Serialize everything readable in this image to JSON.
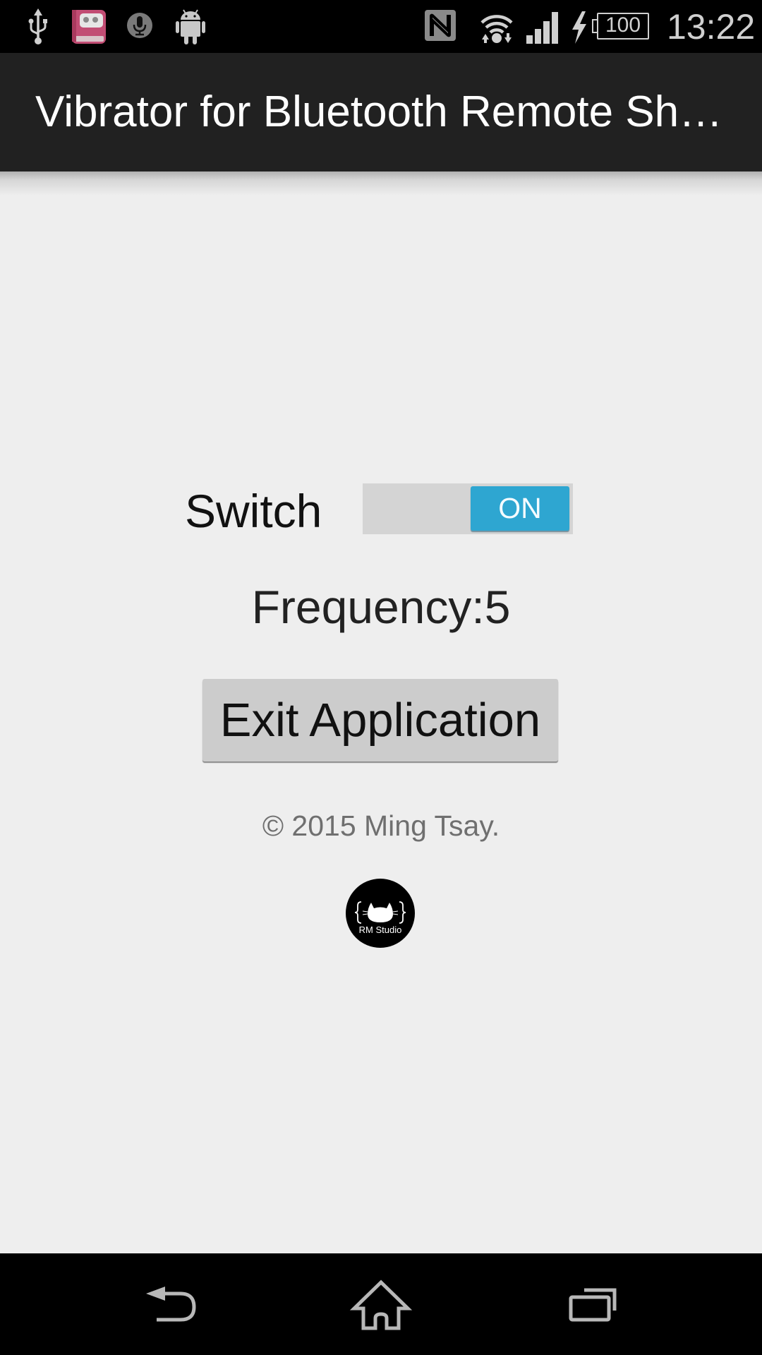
{
  "status_bar": {
    "left_icons": [
      "usb-icon",
      "diary-app-icon",
      "microphone-icon",
      "android-icon"
    ],
    "right_icons": [
      "nfc-icon",
      "wifi-icon",
      "cell-signal-icon",
      "charging-bolt-icon",
      "battery-icon"
    ],
    "battery_level": "100",
    "time": "13:22"
  },
  "action_bar": {
    "title": "Vibrator for Bluetooth Remote Shutter"
  },
  "main": {
    "switch_label": "Switch",
    "switch_state": "ON",
    "switch_on": true,
    "frequency_label": "Frequency:5",
    "exit_button_label": "Exit Application",
    "copyright": "© 2015 Ming Tsay.",
    "logo_text": "RM Studio"
  },
  "nav_bar": {
    "buttons": [
      "back",
      "home",
      "recents"
    ]
  },
  "colors": {
    "action_bar": "#212121",
    "background": "#eeeeee",
    "switch_on": "#2ea6d1",
    "switch_track": "#d4d4d4",
    "button": "#cccccc"
  }
}
